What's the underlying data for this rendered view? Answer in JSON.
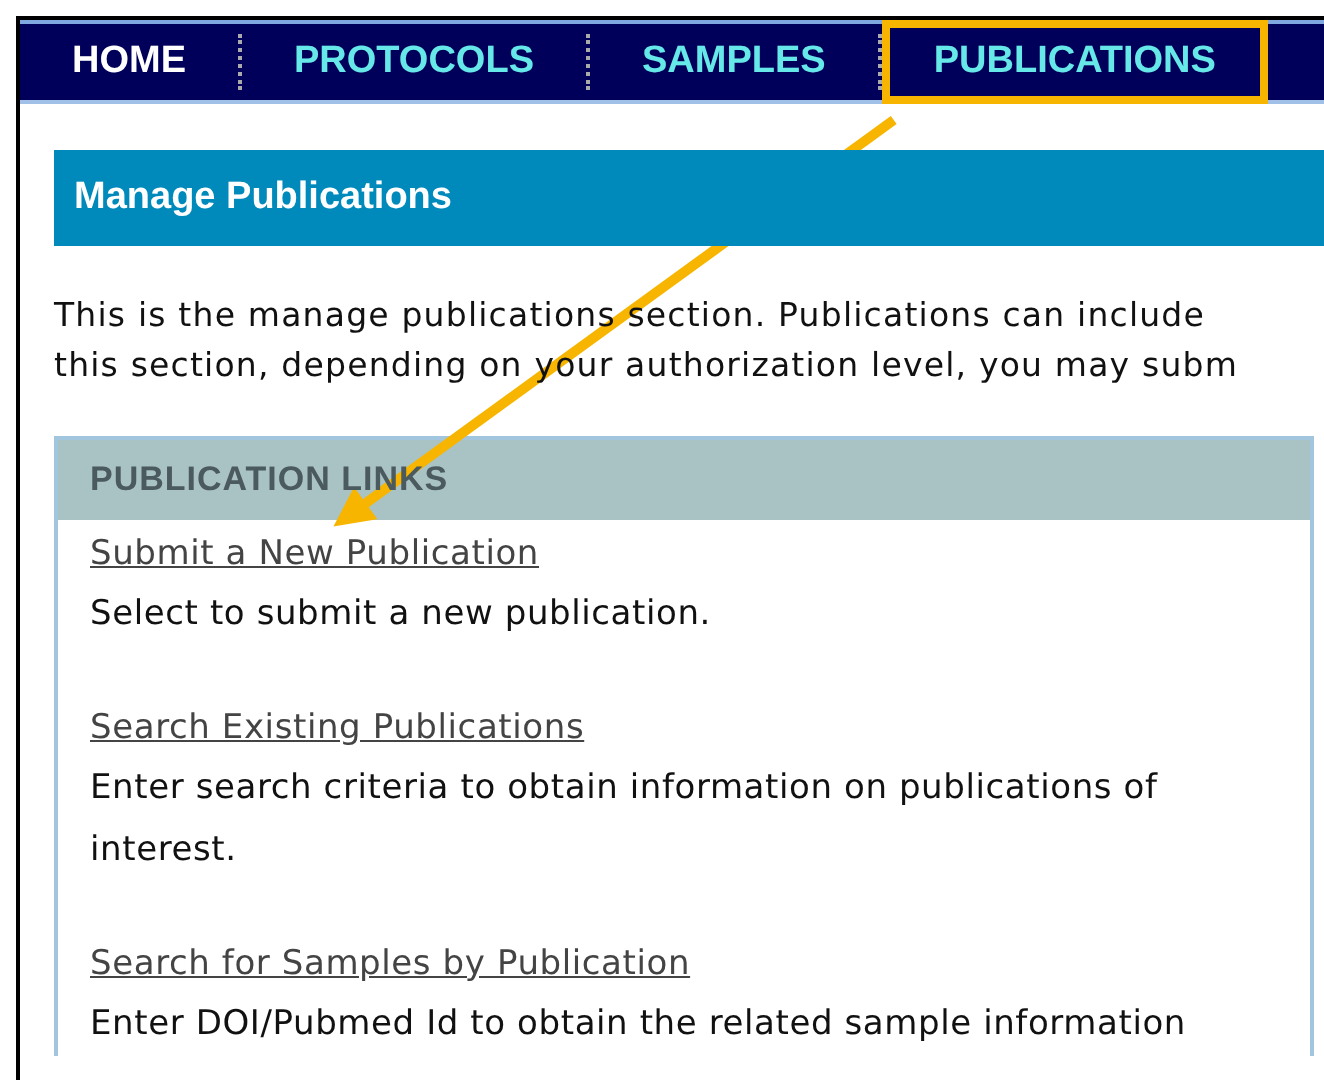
{
  "nav": {
    "tabs": [
      {
        "label": "HOME",
        "selected": true,
        "highlighted": false
      },
      {
        "label": "PROTOCOLS",
        "selected": false,
        "highlighted": false
      },
      {
        "label": "SAMPLES",
        "selected": false,
        "highlighted": false
      },
      {
        "label": "PUBLICATIONS",
        "selected": false,
        "highlighted": true
      }
    ]
  },
  "page_title": "Manage Publications",
  "intro": [
    "This is the manage publications section. Publications can include",
    "this section, depending on your authorization level, you may subm"
  ],
  "panel": {
    "title": "PUBLICATION LINKS",
    "links": [
      {
        "label": "Submit a New Publication",
        "description": "Select to submit a new publication."
      },
      {
        "label": "Search Existing Publications",
        "description": "Enter search criteria to obtain information on publications of interest."
      },
      {
        "label": "Search for Samples by Publication",
        "description": "Enter DOI/Pubmed Id to obtain the related sample information"
      }
    ]
  }
}
